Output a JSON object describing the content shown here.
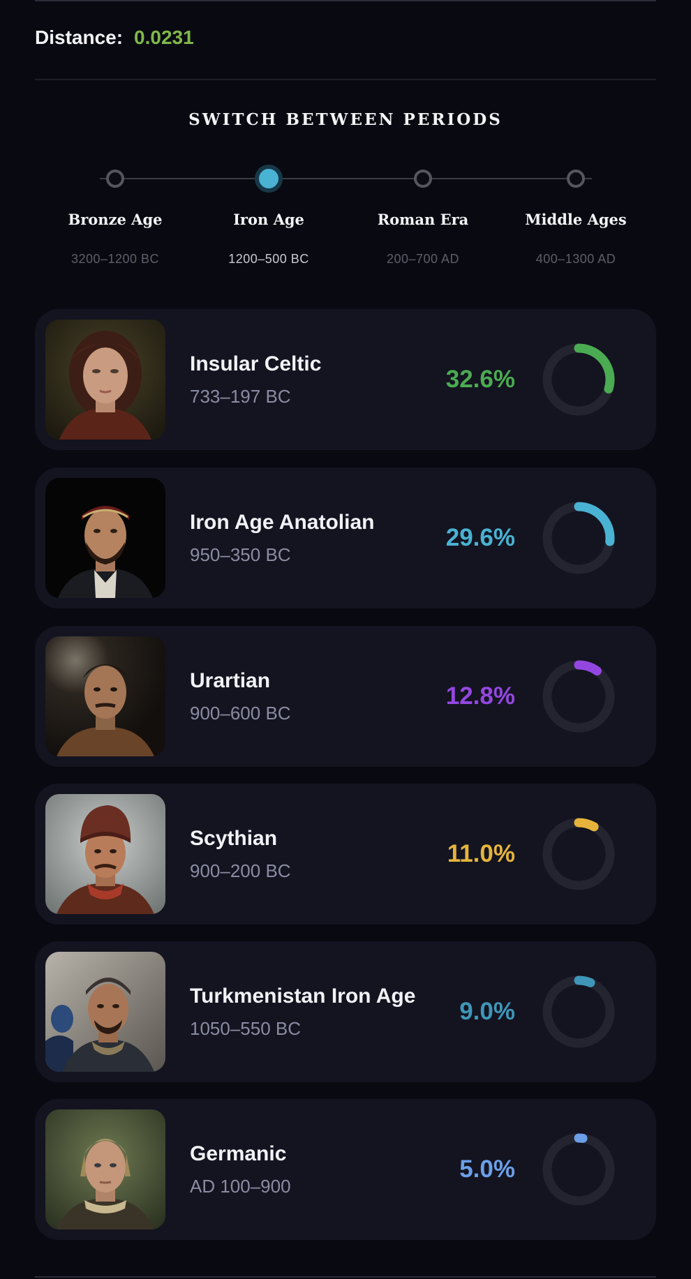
{
  "distance": {
    "label": "Distance:",
    "value": "0.0231",
    "value_color": "#7fb84a"
  },
  "switcher": {
    "title": "SWITCH BETWEEN PERIODS",
    "periods": [
      {
        "name": "Bronze Age",
        "range": "3200–1200 BC",
        "active": false
      },
      {
        "name": "Iron Age",
        "range": "1200–500 BC",
        "active": true
      },
      {
        "name": "Roman Era",
        "range": "200–700 AD",
        "active": false
      },
      {
        "name": "Middle Ages",
        "range": "400–1300 AD",
        "active": false
      }
    ]
  },
  "populations": [
    {
      "name": "Insular Celtic",
      "range": "733–197 BC",
      "percent_label": "32.6%",
      "percent": 32.6,
      "color": "#4bab52",
      "portrait": "portrait-woman-dark-hair"
    },
    {
      "name": "Iron Age Anatolian",
      "range": "950–350 BC",
      "percent_label": "29.6%",
      "percent": 29.6,
      "color": "#4ab2d3",
      "portrait": "portrait-man-headband"
    },
    {
      "name": "Urartian",
      "range": "900–600 BC",
      "percent_label": "12.8%",
      "percent": 12.8,
      "color": "#9447e0",
      "portrait": "portrait-man-dark"
    },
    {
      "name": "Scythian",
      "range": "900–200 BC",
      "percent_label": "11.0%",
      "percent": 11.0,
      "color": "#e6b43c",
      "portrait": "portrait-man-red-hat"
    },
    {
      "name": "Turkmenistan Iron Age",
      "range": "1050–550 BC",
      "percent_label": "9.0%",
      "percent": 9.0,
      "color": "#3f96b8",
      "portrait": "portrait-man-cap-mountains"
    },
    {
      "name": "Germanic",
      "range": "AD 100–900",
      "percent_label": "5.0%",
      "percent": 5.0,
      "color": "#6c9fe8",
      "portrait": "portrait-man-blond"
    }
  ]
}
